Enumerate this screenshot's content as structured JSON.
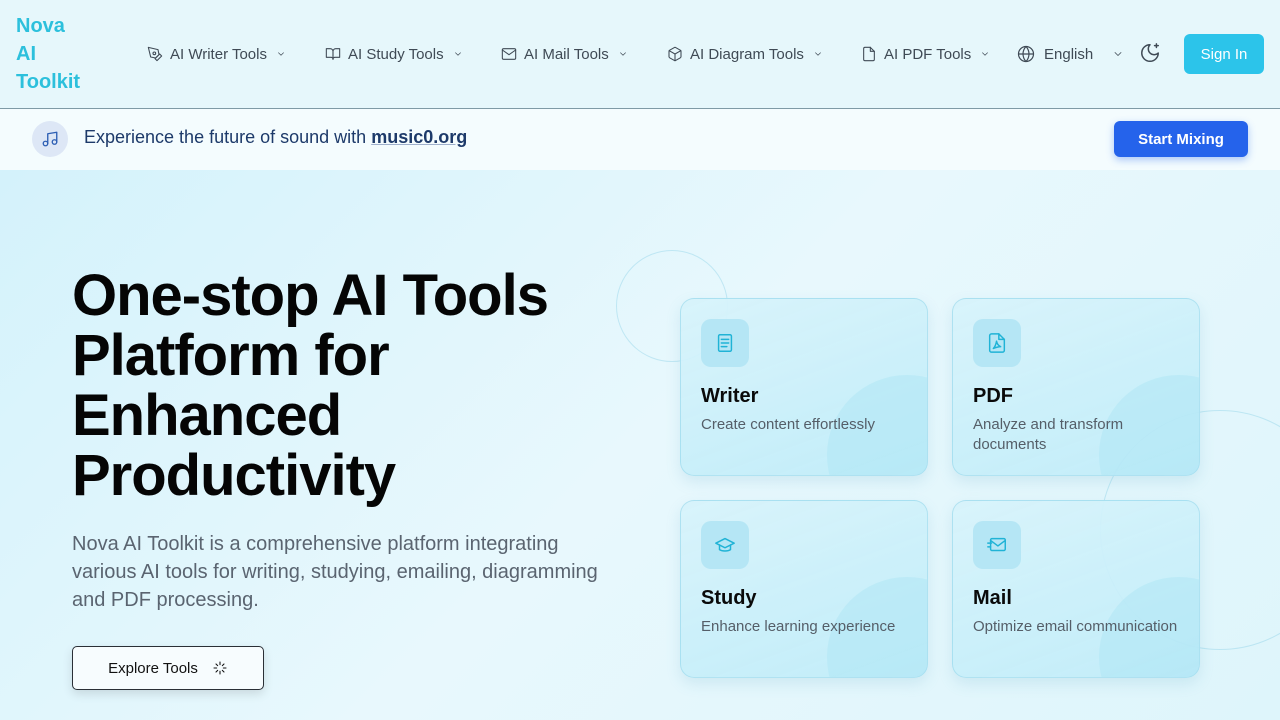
{
  "logo": {
    "line1": "Nova",
    "line2": "AI",
    "line3": "Toolkit"
  },
  "nav": {
    "items": [
      {
        "label": "AI Writer Tools",
        "icon": "pen-tool-icon"
      },
      {
        "label": "AI Study Tools",
        "icon": "book-open-icon"
      },
      {
        "label": "AI Mail Tools",
        "icon": "mail-icon"
      },
      {
        "label": "AI Diagram Tools",
        "icon": "box-icon"
      },
      {
        "label": "AI PDF Tools",
        "icon": "file-icon"
      }
    ],
    "language": "English",
    "signin_label": "Sign In"
  },
  "banner": {
    "text": "Experience the future of sound with ",
    "link": "music0.org",
    "button": "Start Mixing"
  },
  "hero": {
    "title_lines": [
      "One-stop AI Tools",
      "Platform for",
      "Enhanced",
      "Productivity"
    ],
    "description": "Nova AI Toolkit is a comprehensive platform integrating various AI tools for writing, studying, emailing, diagramming and PDF processing.",
    "explore_label": "Explore Tools"
  },
  "cards": [
    {
      "title": "Writer",
      "desc": "Create content effortlessly",
      "icon": "document-text-icon"
    },
    {
      "title": "PDF",
      "desc": "Analyze and transform documents",
      "icon": "pdf-file-icon"
    },
    {
      "title": "Study",
      "desc": "Enhance learning experience",
      "icon": "graduation-cap-icon"
    },
    {
      "title": "Mail",
      "desc": "Optimize email communication",
      "icon": "mail-send-icon"
    }
  ],
  "colors": {
    "brand": "#2cc0dc",
    "signin": "#2cc4ea",
    "banner_button": "#2563eb",
    "card_icon": "#20b3d6"
  }
}
